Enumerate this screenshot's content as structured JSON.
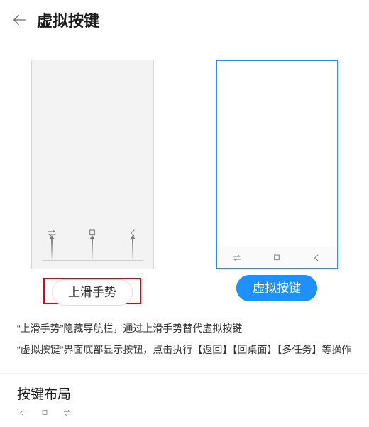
{
  "header": {
    "title": "虚拟按键"
  },
  "options": {
    "swipe": {
      "label": "上滑手势"
    },
    "keys": {
      "label": "虚拟按键"
    }
  },
  "desc": {
    "line1": "“上滑手势”隐藏导航栏，通过上滑手势替代虚拟按键",
    "line2": "“虚拟按键”界面底部显示按钮，点击执行【返回】【回桌面】【多任务】等操作"
  },
  "layout": {
    "title": "按键布局"
  }
}
